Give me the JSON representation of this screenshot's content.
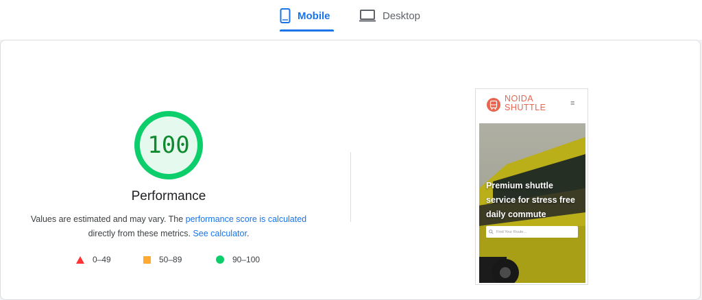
{
  "tabs": [
    {
      "label": "Mobile",
      "icon": "mobile-icon",
      "active": true
    },
    {
      "label": "Desktop",
      "icon": "desktop-icon",
      "active": false
    }
  ],
  "score": {
    "value": "100",
    "fraction": 1.0,
    "color": "#0cce6b",
    "label": "Performance"
  },
  "description": {
    "part1": "Values are estimated and may vary. The ",
    "link1": "performance score is calculated",
    "part2": " directly from these metrics. ",
    "link2": "See calculator",
    "part3": "."
  },
  "legend": [
    {
      "range": "0–49",
      "shape": "triangle",
      "color": "#ff3333"
    },
    {
      "range": "50–89",
      "shape": "square",
      "color": "#ffaa33"
    },
    {
      "range": "90–100",
      "shape": "circle",
      "color": "#0cce6b"
    }
  ],
  "screenshot": {
    "brand_line1": "NOIDA",
    "brand_line2": "SHUTTLE",
    "hero_text": "Premium shuttle service for stress free daily commute",
    "search_placeholder": "Find Your Route..."
  },
  "colors": {
    "accent": "#1a73e8",
    "brand": "#e8644f"
  }
}
